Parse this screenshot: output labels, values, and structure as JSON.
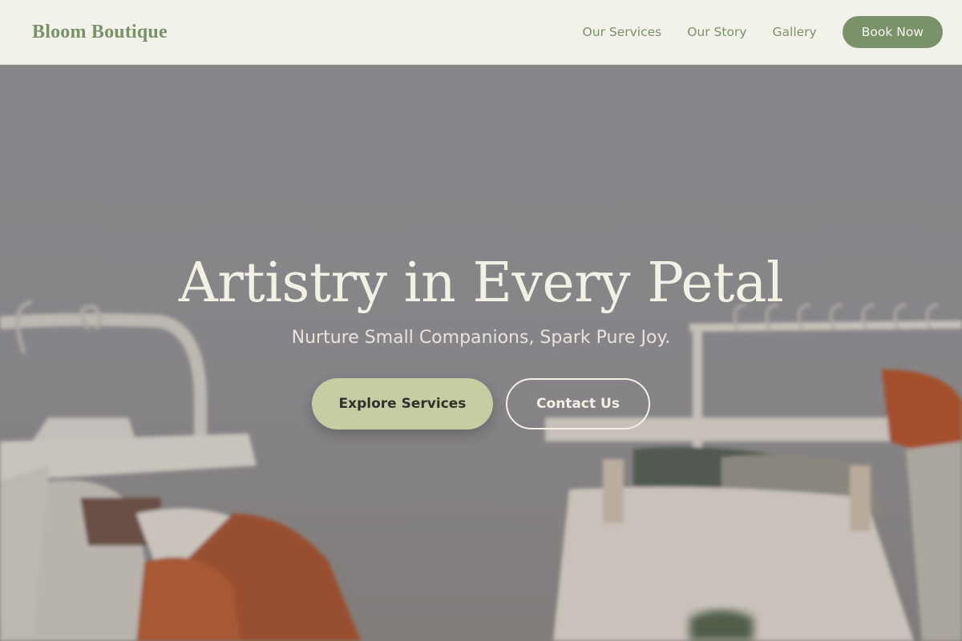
{
  "nav": {
    "brand": "Bloom Boutique",
    "links": [
      "Our Services",
      "Our Story",
      "Gallery"
    ],
    "cta": "Book Now"
  },
  "hero": {
    "title": "Artistry in Every Petal",
    "subtitle": "Nurture Small Companions, Spark Pure Joy.",
    "primary_button": "Explore Services",
    "secondary_button": "Contact Us",
    "background_image": "clothing-rack-photo"
  },
  "colors": {
    "nav_background": "#f2f2ea",
    "brand": "#7b9169",
    "primary_button": "#c7cca2",
    "text_light": "#f3f1e6"
  }
}
